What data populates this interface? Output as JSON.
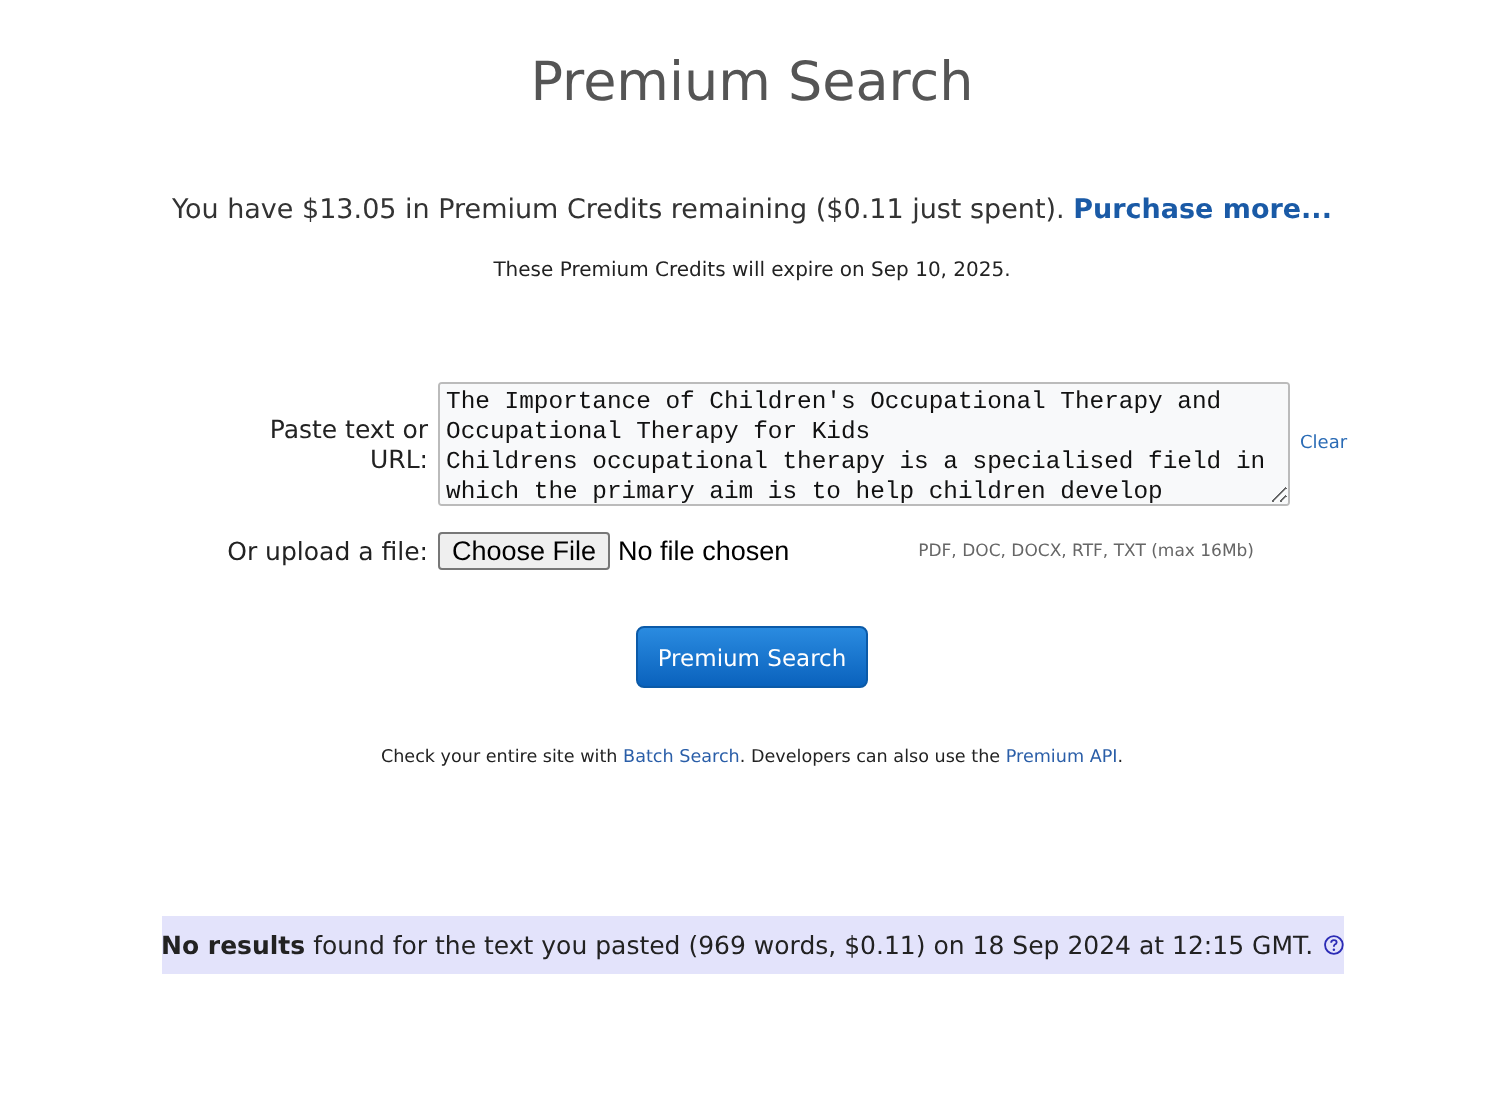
{
  "title": "Premium Search",
  "credits": {
    "text": "You have $13.05 in Premium Credits remaining ($0.11 just spent).",
    "link": "Purchase more..."
  },
  "expiry": "These Premium Credits will expire on Sep 10, 2025.",
  "paste": {
    "label": "Paste text or URL:",
    "value": "The Importance of Children's Occupational Therapy and Occupational Therapy for Kids\nChildrens occupational therapy is a specialised field in which the primary aim is to help children develop",
    "clear": "Clear"
  },
  "upload": {
    "label": "Or upload a file:",
    "button": "Choose File",
    "status": "No file chosen",
    "hint": "PDF, DOC, DOCX, RTF, TXT (max 16Mb)"
  },
  "submit": "Premium Search",
  "footer": [
    {
      "kind": "text",
      "text": "Check your entire site with "
    },
    {
      "kind": "link",
      "text": "Batch Search"
    },
    {
      "kind": "text",
      "text": ". Developers can also use the "
    },
    {
      "kind": "link",
      "text": "Premium API"
    },
    {
      "kind": "text",
      "text": "."
    }
  ],
  "result": "**No results** found for the text you pasted (969 words, $0.11) on 18 Sep 2024 at 12:15 GMT."
}
